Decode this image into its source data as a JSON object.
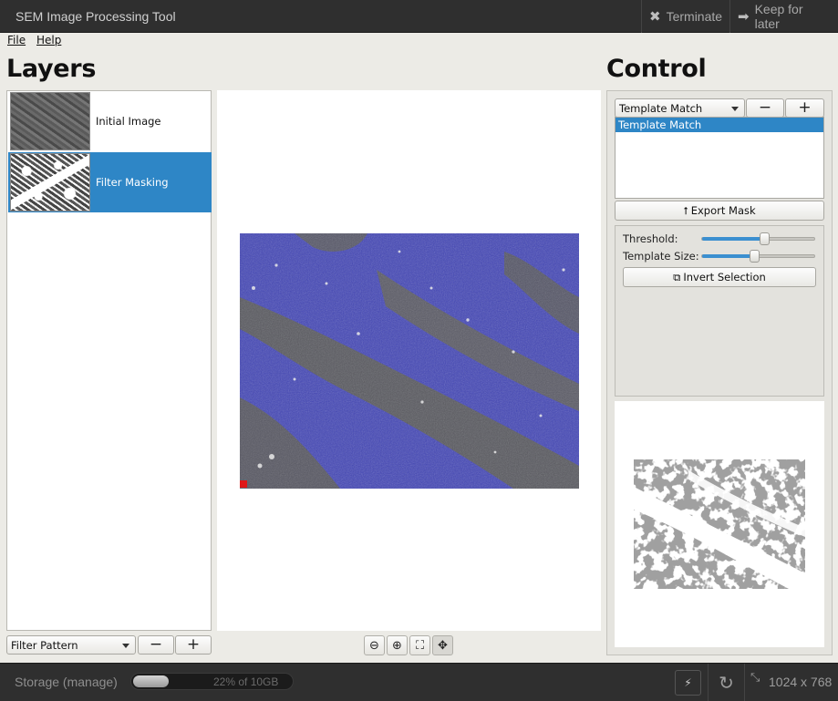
{
  "app": {
    "title": "SEM Image Processing Tool",
    "terminate_label": "Terminate",
    "keep_label": "Keep for later"
  },
  "menu": {
    "file": "File",
    "help": "Help"
  },
  "layers": {
    "heading": "Layers",
    "items": [
      {
        "label": "Initial Image",
        "selected": false
      },
      {
        "label": "Filter Masking",
        "selected": true
      }
    ],
    "combo_value": "Filter Pattern",
    "minus": "−",
    "plus": "+"
  },
  "control": {
    "heading": "Control",
    "combo_value": "Template Match",
    "minus": "−",
    "plus": "+",
    "list_items": [
      "Template Match"
    ],
    "export_label": "Export Mask",
    "threshold_label": "Threshold:",
    "threshold_value": 0.56,
    "template_size_label": "Template Size:",
    "template_size_value": 0.47,
    "invert_label": "Invert Selection"
  },
  "zoom_tools": [
    "zoom-out",
    "zoom-in",
    "fit",
    "pan"
  ],
  "status": {
    "storage_label": "Storage (manage)",
    "storage_percent": 22,
    "storage_text": "22% of 10GB",
    "dimensions": "1024 x 768"
  },
  "colors": {
    "selection": "#2e86c6",
    "mask_overlay": "#3f43c4",
    "topbar": "#2f2f2f"
  }
}
